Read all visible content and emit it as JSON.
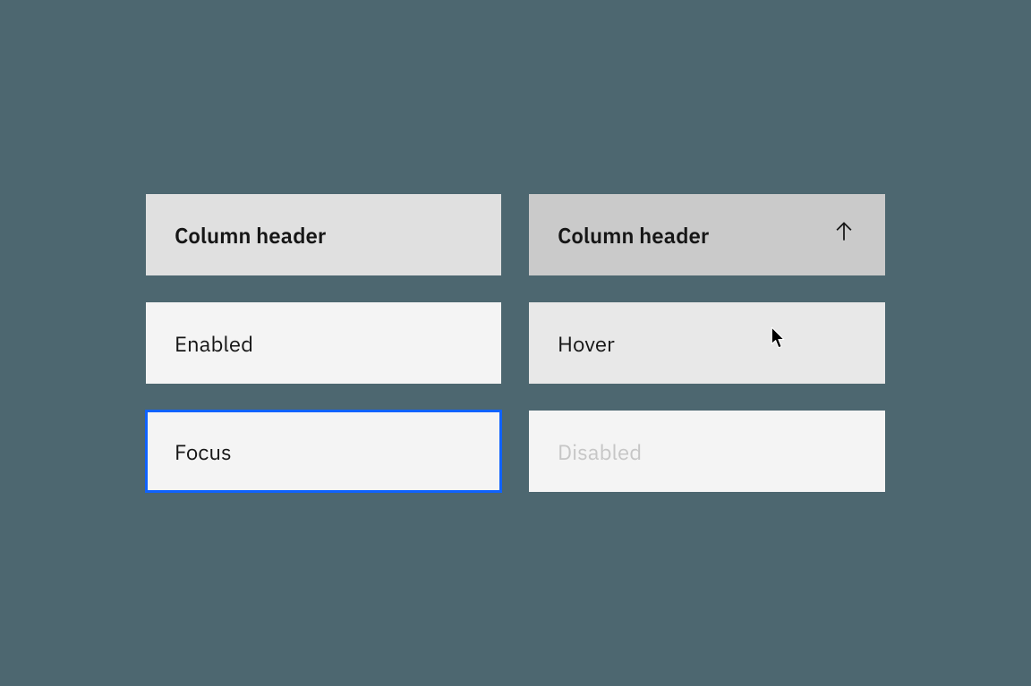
{
  "cells": {
    "header_default": {
      "label": "Column header"
    },
    "header_hover": {
      "label": "Column header",
      "icon": "arrow-up"
    },
    "row_enabled": {
      "label": "Enabled"
    },
    "row_hover": {
      "label": "Hover",
      "cursor": "pointer"
    },
    "row_focus": {
      "label": "Focus"
    },
    "row_disabled": {
      "label": "Disabled"
    }
  },
  "colors": {
    "background": "#4d6770",
    "header_default_bg": "#e0e0e0",
    "header_hover_bg": "#cacaca",
    "row_default_bg": "#f4f4f4",
    "row_hover_bg": "#e8e8e8",
    "focus_outline": "#0f62fe",
    "text": "#161616",
    "text_disabled": "#c6c6c6"
  }
}
